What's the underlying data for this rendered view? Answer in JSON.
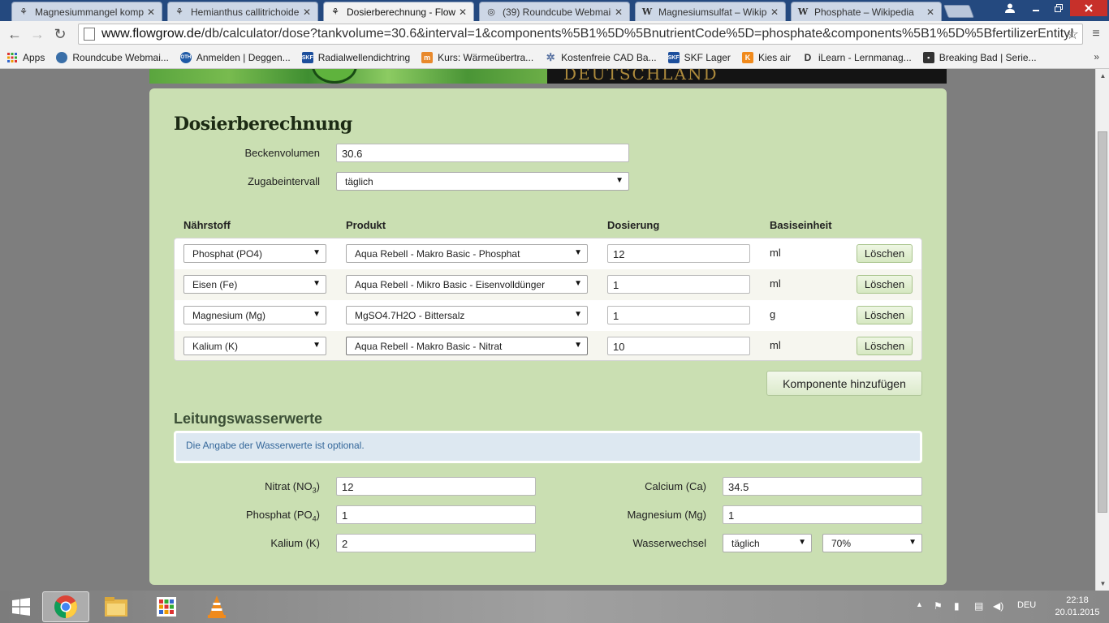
{
  "browser": {
    "tabs": [
      {
        "title": "Magnesiummangel komp",
        "active": false
      },
      {
        "title": "Hemianthus callitrichoide",
        "active": false
      },
      {
        "title": "Dosierberechnung - Flowg",
        "active": true
      },
      {
        "title": "(39) Roundcube Webmail",
        "active": false
      },
      {
        "title": "Magnesiumsulfat – Wikipe",
        "active": false
      },
      {
        "title": "Phosphate – Wikipedia",
        "active": false
      }
    ],
    "url_host": "www.flowgrow.de",
    "url_path": "/db/calculator/dose?tankvolume=30.6&interval=1&components%5B1%5D%5BnutrientCode%5D=phosphate&components%5B1%5D%5BfertilizerEntityI",
    "bookmarks": [
      {
        "label": "Apps",
        "icon": "apps-grid-icon"
      },
      {
        "label": "Roundcube Webmai...",
        "icon": "roundcube-icon"
      },
      {
        "label": "Anmelden | Deggen...",
        "icon": "oth-icon"
      },
      {
        "label": "Radialwellendichtring",
        "icon": "skf-icon"
      },
      {
        "label": "Kurs: Wärmeübertra...",
        "icon": "moodle-icon"
      },
      {
        "label": "Kostenfreie CAD Ba...",
        "icon": "gear-icon"
      },
      {
        "label": "SKF Lager",
        "icon": "skf-icon"
      },
      {
        "label": "Kies air",
        "icon": "kiesair-icon"
      },
      {
        "label": "iLearn - Lernmanag...",
        "icon": "ilearn-icon"
      },
      {
        "label": "Breaking Bad | Serie...",
        "icon": "tv-icon"
      }
    ],
    "bookmarks_more": "»"
  },
  "page": {
    "banner_text": "DEUTSCHLAND",
    "title": "Dosierberechnung",
    "tank_volume_label": "Beckenvolumen",
    "tank_volume_value": "30.6",
    "interval_label": "Zugabeintervall",
    "interval_value": "täglich",
    "columns": {
      "nutrient": "Nährstoff",
      "product": "Produkt",
      "dosage": "Dosierung",
      "base_unit": "Basiseinheit"
    },
    "components": [
      {
        "nutrient": "Phosphat (PO4)",
        "product": "Aqua Rebell - Makro Basic - Phosphat",
        "dose": "12",
        "unit": "ml",
        "delete": "Löschen"
      },
      {
        "nutrient": "Eisen (Fe)",
        "product": "Aqua Rebell - Mikro Basic - Eisenvolldünger",
        "dose": "1",
        "unit": "ml",
        "delete": "Löschen"
      },
      {
        "nutrient": "Magnesium (Mg)",
        "product": "MgSO4.7H2O - Bittersalz",
        "dose": "1",
        "unit": "g",
        "delete": "Löschen"
      },
      {
        "nutrient": "Kalium (K)",
        "product": "Aqua Rebell - Makro Basic - Nitrat",
        "dose": "10",
        "unit": "ml",
        "delete": "Löschen"
      }
    ],
    "add_component": "Komponente hinzufügen",
    "tapwater_title": "Leitungswasserwerte",
    "tapwater_info": "Die Angabe der Wasserwerte ist optional.",
    "tapwater": {
      "nitrate_label": "Nitrat (NO",
      "nitrate_sub": "3",
      "nitrate_value": "12",
      "phosphate_label": "Phosphat (PO",
      "phosphate_sub": "4",
      "phosphate_value": "1",
      "potassium_label": "Kalium (K)",
      "potassium_value": "2",
      "calcium_label": "Calcium (Ca)",
      "calcium_value": "34.5",
      "magnesium_label": "Magnesium (Mg)",
      "magnesium_value": "1",
      "waterchange_label": "Wasserwechsel",
      "waterchange_interval": "täglich",
      "waterchange_percent": "70%"
    }
  },
  "taskbar": {
    "language": "DEU",
    "time": "22:18",
    "date": "20.01.2015"
  }
}
